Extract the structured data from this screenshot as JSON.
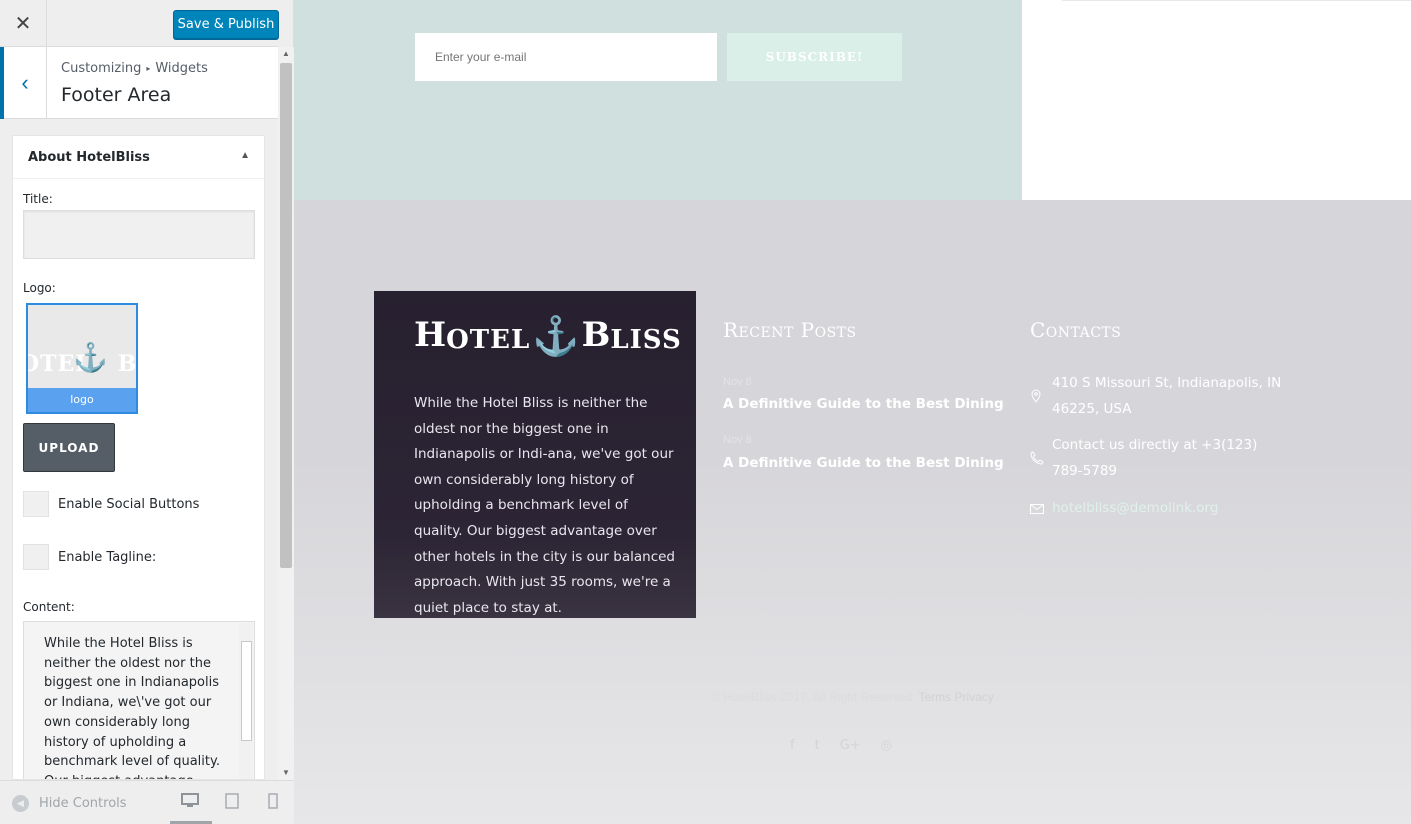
{
  "topbar": {
    "close_icon": "✕",
    "publish_label": "Save & Publish"
  },
  "section": {
    "back_icon": "‹",
    "crumb_parent": "Customizing",
    "crumb_sep": "▸",
    "crumb_child": "Widgets",
    "title": "Footer Area"
  },
  "widget": {
    "title": "About HotelBliss",
    "toggle_icon": "▲",
    "title_label": "Title:",
    "title_value": "",
    "logo_label": "Logo:",
    "logo_caption": "logo",
    "upload_label": "UPLOAD",
    "social_label": "Enable Social Buttons",
    "tagline_label": "Enable Tagline:",
    "content_label": "Content:",
    "content_value": "While the Hotel Bliss is neither the oldest nor the biggest one in Indianapolis or Indiana, we\\'ve got our own considerably long history of upholding a benchmark level of quality. Our biggest advantage over"
  },
  "footerbar": {
    "hide_label": "Hide Controls",
    "hide_icon": "◀",
    "devices": [
      "desktop-icon",
      "tablet-icon",
      "mobile-icon"
    ]
  },
  "preview": {
    "email_placeholder": "Enter your e-mail",
    "subscribe_label": "SUBSCRIBE!",
    "brand": {
      "part1_big": "H",
      "part1_small": "OTEL",
      "anchor": "⚓",
      "part2_big": "B",
      "part2_small": "LISS"
    },
    "about_text": "While the Hotel Bliss is neither the oldest nor the biggest one in Indianapolis or Indi-ana, we've got our own considerably long history of upholding a benchmark level of quality. Our biggest advantage over other hotels in the city is our balanced approach. With just 35 rooms, we're a quiet place to stay at.",
    "recent_posts_title": "Recent Posts",
    "posts": [
      {
        "date": "Nov 8",
        "title": "A Definitive Guide to the Best Dining"
      },
      {
        "date": "Nov 8",
        "title": "A Definitive Guide to the Best Dining"
      }
    ],
    "contacts_title": "Contacts",
    "address": "410 S Missouri St, Indianapolis, IN 46225, USA",
    "phone": "Contact us directly at +3(123) 789-5789",
    "email": "hotelbliss@demolink.org",
    "copyright": "© HotelBliss 2017. All Right Reserved.",
    "terms": "Terms",
    "privacy": "Privacy",
    "socials": [
      "f",
      "t",
      "G+",
      "◎"
    ]
  },
  "colors": {
    "accent": "#0085ba",
    "anchor": "#3cc4a3",
    "about_bg": "#27202f"
  }
}
